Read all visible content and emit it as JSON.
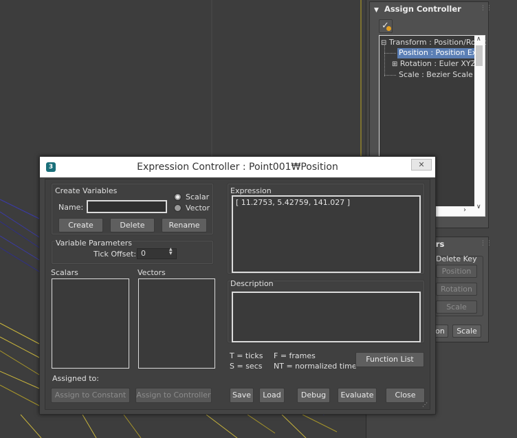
{
  "colors": {
    "viewport_bg": "#3d3d3d",
    "panel_bg": "#444444",
    "selection": "#5b7fb5",
    "wire_yellow": "#c8b43c",
    "wire_blue": "#3a3aa8"
  },
  "assign_controller": {
    "title": "Assign Controller",
    "tree": [
      {
        "label": "Transform : Position/Rotat",
        "expander": "⊟"
      },
      {
        "label": "Position : Position Expr",
        "selected": true
      },
      {
        "label": "Rotation : Euler XYZ",
        "expander": "⊞"
      },
      {
        "label": "Scale : Bezier Scale"
      }
    ]
  },
  "partial_rollout": {
    "title": "ers",
    "delete_key_label": "Delete Key",
    "buttons": [
      "Position",
      "Rotation",
      "Scale"
    ],
    "bottom_buttons": [
      "on",
      "Scale"
    ]
  },
  "dialog": {
    "title": "Expression Controller : Point001₩Position",
    "close": "✕",
    "create_variables": {
      "title": "Create Variables",
      "name_label": "Name:",
      "name_value": "",
      "scalar_label": "Scalar",
      "vector_label": "Vector",
      "selected_type": "Scalar",
      "create": "Create",
      "delete": "Delete",
      "rename": "Rename"
    },
    "variable_parameters": {
      "title": "Variable Parameters",
      "tick_offset_label": "Tick Offset:",
      "tick_offset_value": "0"
    },
    "scalars_label": "Scalars",
    "vectors_label": "Vectors",
    "assigned_to_label": "Assigned to:",
    "assign_constant": "Assign to Constant",
    "assign_controller": "Assign to Controller",
    "expression_label": "Expression",
    "expression_value": "[ 11.2753, 5.42759, 141.027 ]",
    "description_label": "Description",
    "description_value": "",
    "legend": {
      "t": "T = ticks",
      "f": "F = frames",
      "s": "S = secs",
      "nt": "NT = normalized time"
    },
    "function_list": "Function List",
    "save": "Save",
    "load": "Load",
    "debug": "Debug",
    "evaluate": "Evaluate",
    "close_button": "Close"
  }
}
